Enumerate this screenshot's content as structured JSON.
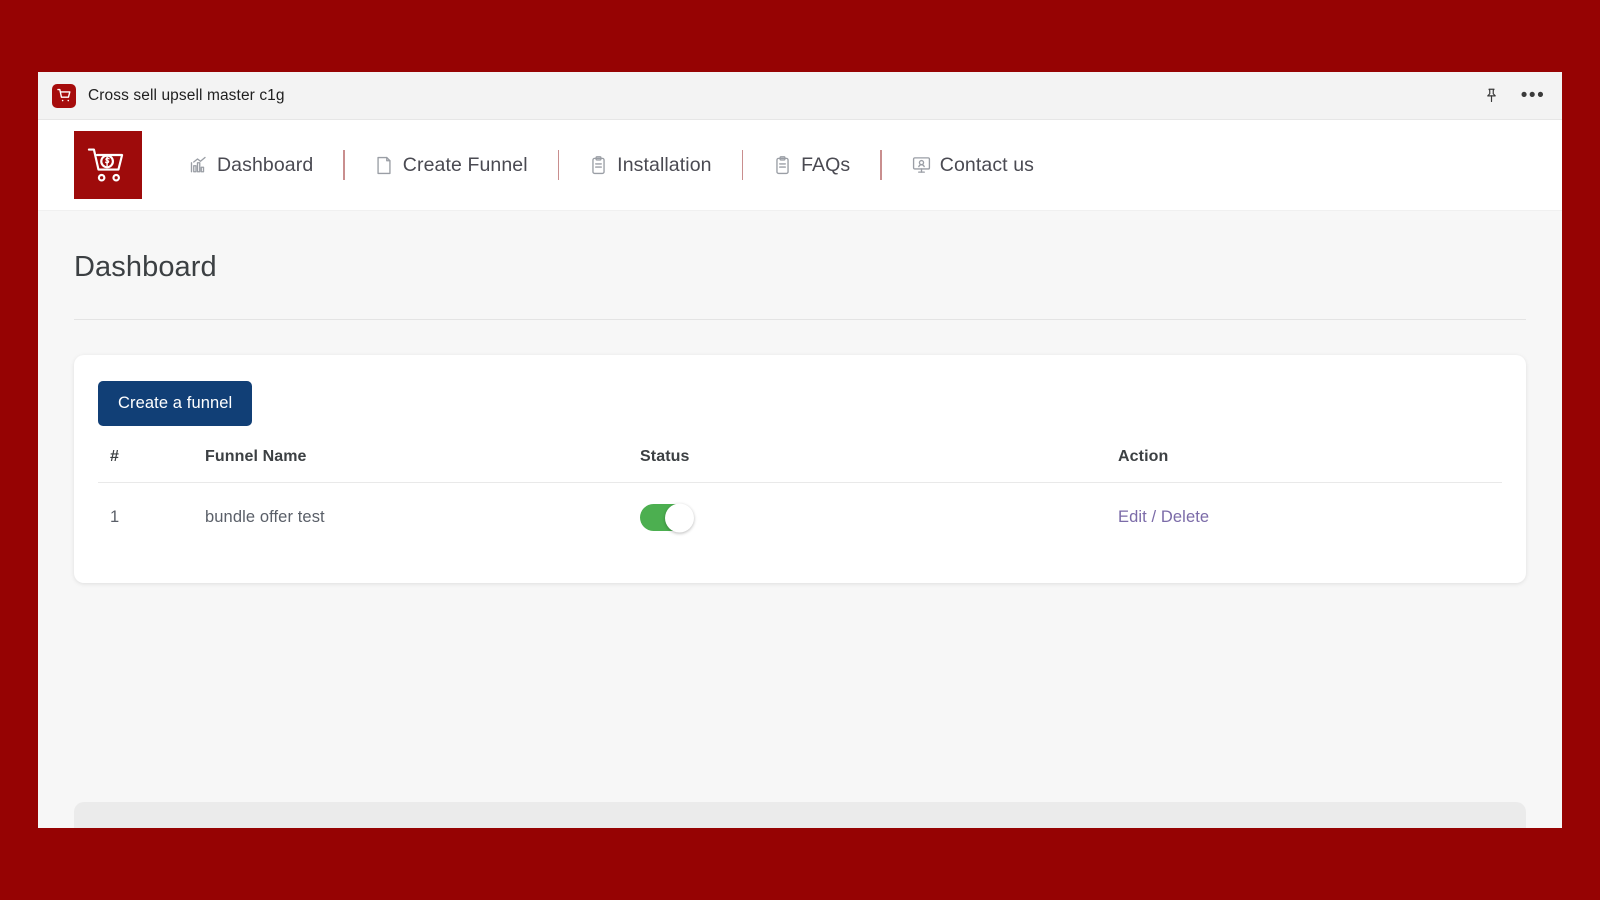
{
  "colors": {
    "page_background": "#960303",
    "brand_red": "#9e0b0b",
    "button_blue": "#113f76",
    "toggle_on_green": "#4caf50",
    "link_purple": "#7b6ba8",
    "nav_divider": "#c98e8e"
  },
  "titlebar": {
    "app_name": "Cross sell upsell master c1g",
    "app_icon": "shopping-cart-icon",
    "pin_icon": "pin-icon",
    "more_icon": "more-options-icon"
  },
  "navbar": {
    "logo_icon": "shopping-cart-dollar-logo",
    "items": [
      {
        "label": "Dashboard",
        "icon": "bar-chart-icon"
      },
      {
        "label": "Create Funnel",
        "icon": "page-icon"
      },
      {
        "label": "Installation",
        "icon": "clipboard-icon"
      },
      {
        "label": "FAQs",
        "icon": "clipboard-icon"
      },
      {
        "label": "Contact us",
        "icon": "monitor-support-icon"
      }
    ]
  },
  "page": {
    "title": "Dashboard"
  },
  "card": {
    "create_button_label": "Create a funnel",
    "table": {
      "headers": [
        "#",
        "Funnel Name",
        "Status",
        "Action"
      ],
      "rows": [
        {
          "num": "1",
          "name": "bundle offer test",
          "status_enabled": "on",
          "action": "Edit / Delete"
        }
      ]
    }
  }
}
